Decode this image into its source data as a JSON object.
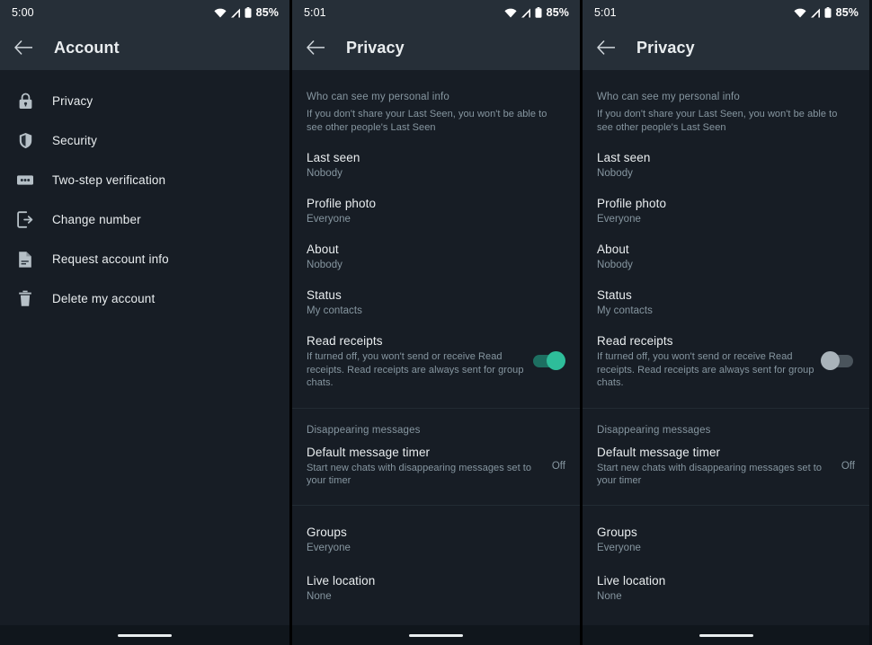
{
  "theme": {
    "background": "#171d25",
    "appbar": "#262f38",
    "primary_text": "#e9edef",
    "secondary_text": "#8696a0",
    "toggle_on_track": "#1d6f61",
    "toggle_on_knob": "#2ebd9a",
    "toggle_off_track": "#4a545c",
    "toggle_off_knob": "#a9b3ba"
  },
  "panels": [
    {
      "id": "account",
      "statusbar": {
        "time": "5:00",
        "battery": "85%",
        "wifi_icon": "wifi-icon",
        "signal_icon": "cellular-signal-icon",
        "battery_icon": "battery-icon"
      },
      "appbar": {
        "back_icon": "back-arrow-icon",
        "title": "Account"
      },
      "account_items": [
        {
          "icon": "lock-icon",
          "label": "Privacy"
        },
        {
          "icon": "shield-icon",
          "label": "Security"
        },
        {
          "icon": "two-step-verification-icon",
          "label": "Two-step verification"
        },
        {
          "icon": "change-number-icon",
          "label": "Change number"
        },
        {
          "icon": "document-icon",
          "label": "Request account info"
        },
        {
          "icon": "trash-icon",
          "label": "Delete my account"
        }
      ]
    },
    {
      "id": "privacy-read-receipts-on",
      "statusbar": {
        "time": "5:01",
        "battery": "85%",
        "wifi_icon": "wifi-icon",
        "signal_icon": "cellular-signal-icon",
        "battery_icon": "battery-icon"
      },
      "appbar": {
        "back_icon": "back-arrow-icon",
        "title": "Privacy"
      },
      "personal_info": {
        "header": "Who can see my personal info",
        "description": "If you don't share your Last Seen, you won't be able to see other people's Last Seen",
        "rows": [
          {
            "title": "Last seen",
            "value": "Nobody"
          },
          {
            "title": "Profile photo",
            "value": "Everyone"
          },
          {
            "title": "About",
            "value": "Nobody"
          },
          {
            "title": "Status",
            "value": "My contacts"
          }
        ],
        "read_receipts": {
          "title": "Read receipts",
          "description": "If turned off, you won't send or receive Read receipts. Read receipts are always sent for group chats.",
          "toggle_state": "on"
        }
      },
      "disappearing": {
        "header": "Disappearing messages",
        "row": {
          "title": "Default message timer",
          "description": "Start new chats with disappearing messages set to your timer",
          "value": "Off"
        }
      },
      "other_rows": [
        {
          "title": "Groups",
          "value": "Everyone"
        },
        {
          "title": "Live location",
          "value": "None"
        }
      ]
    },
    {
      "id": "privacy-read-receipts-off",
      "statusbar": {
        "time": "5:01",
        "battery": "85%",
        "wifi_icon": "wifi-icon",
        "signal_icon": "cellular-signal-icon",
        "battery_icon": "battery-icon"
      },
      "appbar": {
        "back_icon": "back-arrow-icon",
        "title": "Privacy"
      },
      "personal_info": {
        "header": "Who can see my personal info",
        "description": "If you don't share your Last Seen, you won't be able to see other people's Last Seen",
        "rows": [
          {
            "title": "Last seen",
            "value": "Nobody"
          },
          {
            "title": "Profile photo",
            "value": "Everyone"
          },
          {
            "title": "About",
            "value": "Nobody"
          },
          {
            "title": "Status",
            "value": "My contacts"
          }
        ],
        "read_receipts": {
          "title": "Read receipts",
          "description": "If turned off, you won't send or receive Read receipts. Read receipts are always sent for group chats.",
          "toggle_state": "off"
        }
      },
      "disappearing": {
        "header": "Disappearing messages",
        "row": {
          "title": "Default message timer",
          "description": "Start new chats with disappearing messages set to your timer",
          "value": "Off"
        }
      },
      "other_rows": [
        {
          "title": "Groups",
          "value": "Everyone"
        },
        {
          "title": "Live location",
          "value": "None"
        }
      ]
    }
  ]
}
